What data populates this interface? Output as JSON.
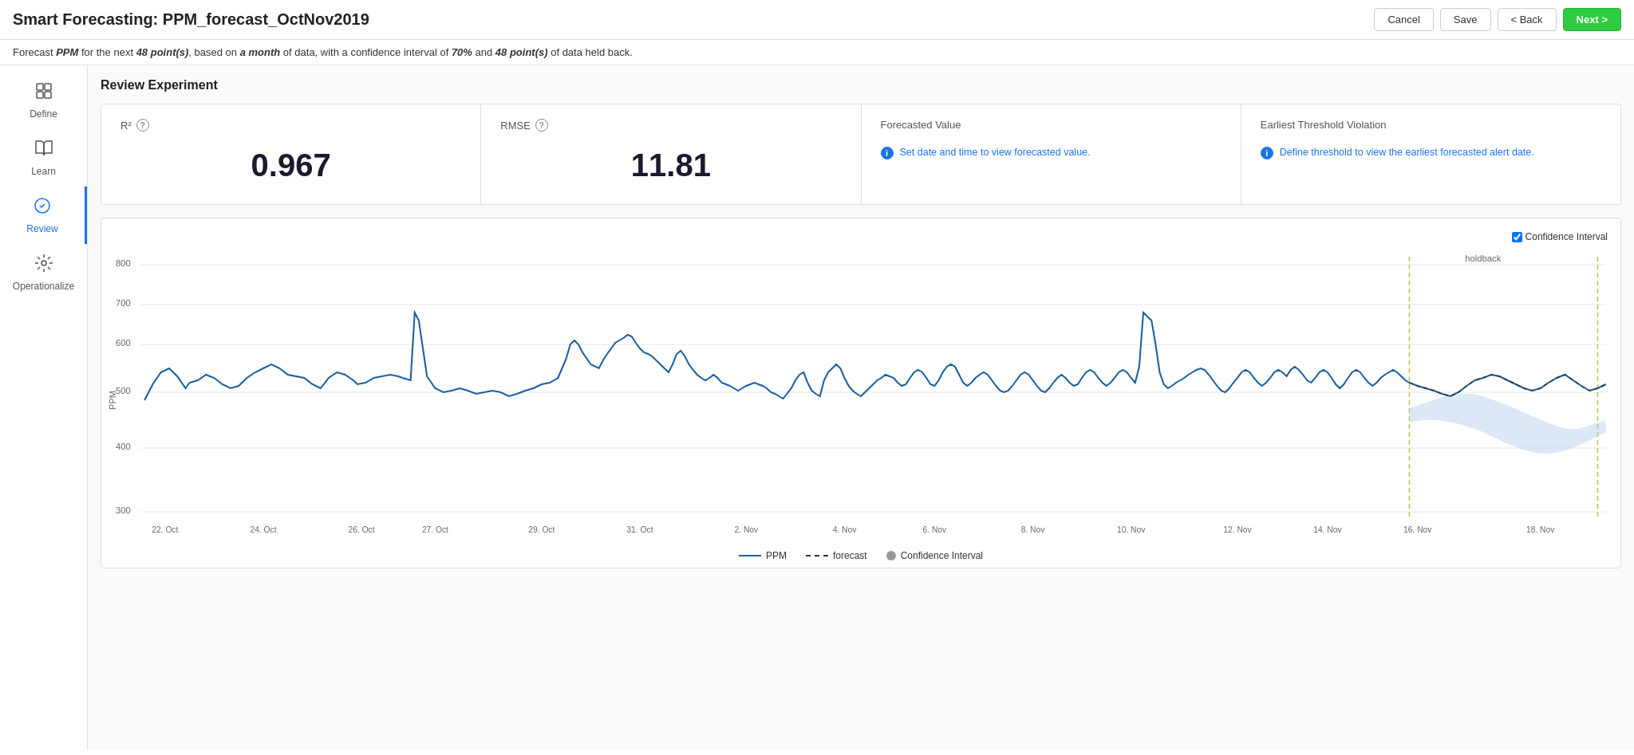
{
  "header": {
    "title": "Smart Forecasting: PPM_forecast_OctNov2019",
    "cancel_label": "Cancel",
    "save_label": "Save",
    "back_label": "< Back",
    "next_label": "Next >"
  },
  "subtitle": {
    "text_parts": [
      "Forecast ",
      "PPM",
      " for the next ",
      "48 point(s)",
      ", based on ",
      "a month",
      " of data, with a confidence interval of ",
      "70%",
      " and ",
      "48 point(s)",
      " of data held back."
    ]
  },
  "sidebar": {
    "items": [
      {
        "id": "define",
        "label": "Define",
        "icon": "⊞",
        "active": false
      },
      {
        "id": "learn",
        "label": "Learn",
        "icon": "📖",
        "active": false
      },
      {
        "id": "review",
        "label": "Review",
        "icon": "✓",
        "active": true
      },
      {
        "id": "operationalize",
        "label": "Operationalize",
        "icon": "⚙",
        "active": false
      }
    ]
  },
  "section": {
    "title": "Review Experiment"
  },
  "metrics": [
    {
      "id": "r2",
      "label": "R²",
      "has_tooltip": true,
      "value": "0.967",
      "has_info": false,
      "info_text": ""
    },
    {
      "id": "rmse",
      "label": "RMSE",
      "has_tooltip": true,
      "value": "11.81",
      "has_info": false,
      "info_text": ""
    },
    {
      "id": "forecasted_value",
      "label": "Forecasted Value",
      "has_tooltip": false,
      "value": "",
      "has_info": true,
      "info_text": "Set date and time to view forecasted value."
    },
    {
      "id": "earliest_threshold",
      "label": "Earliest Threshold Violation",
      "has_tooltip": false,
      "value": "",
      "has_info": true,
      "info_text": "Define threshold to view the earliest forecasted alert date."
    }
  ],
  "chart": {
    "confidence_interval_checked": true,
    "confidence_interval_label": "Confidence Interval",
    "holdback_label": "holdback",
    "y_axis_label": "PPM",
    "y_ticks": [
      "800",
      "700",
      "600",
      "500",
      "400",
      "300"
    ],
    "x_ticks": [
      "22. Oct",
      "24. Oct",
      "26. Oct",
      "27. Oct",
      "29. Oct",
      "31. Oct",
      "2. Nov",
      "4. Nov",
      "6. Nov",
      "8. Nov",
      "10. Nov",
      "12. Nov",
      "14. Nov",
      "16. Nov",
      "18. Nov"
    ],
    "legend": [
      {
        "type": "solid",
        "label": "PPM"
      },
      {
        "type": "dashed",
        "label": "forecast"
      },
      {
        "type": "circle",
        "label": "Confidence Interval"
      }
    ]
  }
}
